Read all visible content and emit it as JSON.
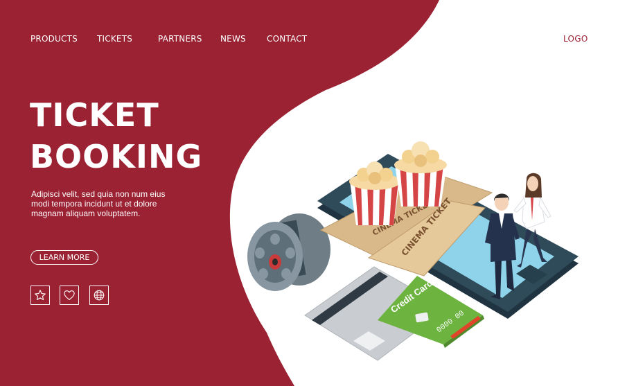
{
  "nav": {
    "items": [
      {
        "label": "PRODUCTS"
      },
      {
        "label": "TICKETS"
      },
      {
        "label": "PARTNERS"
      },
      {
        "label": "NEWS"
      },
      {
        "label": "CONTACT"
      }
    ],
    "logo": "LOGO"
  },
  "hero": {
    "title_line1": "TICKET",
    "title_line2": "BOOKING",
    "description": "Adipisci velit, sed quia non num eius modi tempora incidunt ut et dolore magnam aliquam voluptatem.",
    "button_label": "LEARN MORE"
  },
  "social_icons": [
    "star-icon",
    "heart-icon",
    "globe-icon"
  ],
  "illustration": {
    "ticket_front_text": "CINEMA TICKET",
    "ticket_back_text": "CINEMA TICKET",
    "credit_card_text": "Credit Card",
    "credit_card_number": "0000 00"
  },
  "colors": {
    "brand": "#9b2233",
    "background": "#ffffff",
    "phone": "#2f4a58",
    "screen": "#8fd3ea",
    "card_green": "#6cb33f"
  }
}
